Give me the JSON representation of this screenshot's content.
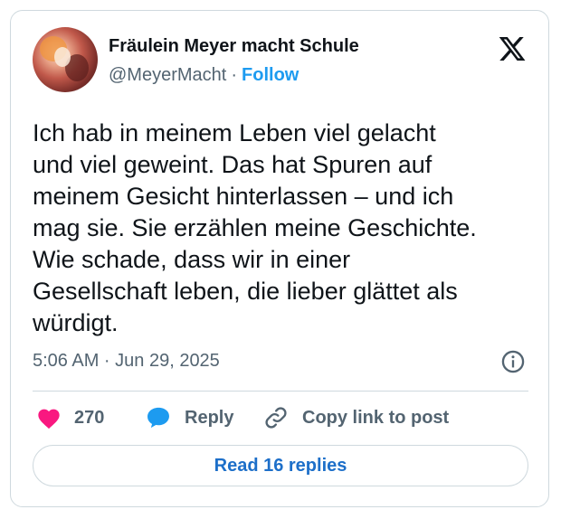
{
  "author": {
    "display_name": "Fräulein Meyer macht Schule",
    "handle": "@MeyerMacht",
    "separator": "·",
    "follow_label": "Follow"
  },
  "tweet": {
    "text": "Ich hab in meinem Leben viel gelacht\nund viel geweint. Das hat Spuren auf\nmeinem Gesicht hinterlassen – und ich\nmag sie. Sie erzählen meine Geschichte.\nWie schade, dass wir in einer\nGesellschaft leben, die lieber glättet als\nwürdigt.",
    "timestamp": "5:06 AM · Jun 29, 2025"
  },
  "actions": {
    "like_count": "270",
    "reply_label": "Reply",
    "copy_link_label": "Copy link to post"
  },
  "read_replies_label": "Read 16 replies",
  "icons": {
    "brand": "x-logo-icon",
    "info": "info-icon",
    "like": "heart-icon",
    "reply": "speech-bubble-icon",
    "copy": "link-icon"
  },
  "colors": {
    "accent": "#1d9bf0",
    "heart": "#f91880",
    "text": "#0f1419",
    "secondary": "#536471",
    "border": "#cfd9de"
  }
}
